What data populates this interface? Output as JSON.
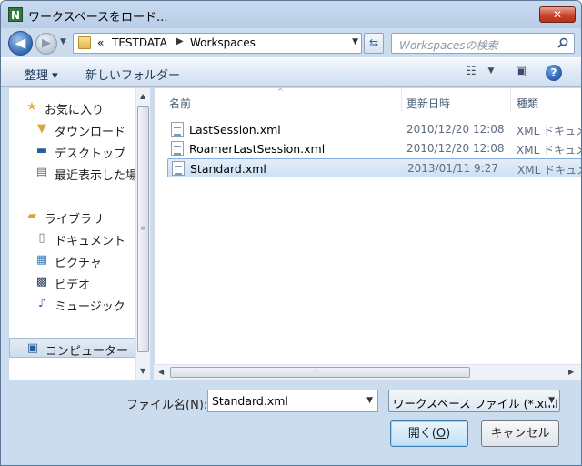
{
  "window": {
    "title": "ワークスペースをロード...",
    "app_icon_letter": "N"
  },
  "address": {
    "overflow": "«",
    "crumbs": [
      "TESTDATA",
      "Workspaces"
    ]
  },
  "search": {
    "placeholder": "Workspacesの検索"
  },
  "toolbar": {
    "organize": "整理 ▾",
    "new_folder": "新しいフォルダー"
  },
  "nav": {
    "favorites": "お気に入り",
    "downloads": "ダウンロード",
    "desktop": "デスクトップ",
    "recent": "最近表示した場所",
    "libraries": "ライブラリ",
    "documents": "ドキュメント",
    "pictures": "ピクチャ",
    "videos": "ビデオ",
    "music": "ミュージック",
    "computer": "コンピューター"
  },
  "columns": {
    "name": "名前",
    "date": "更新日時",
    "type": "種類"
  },
  "files": [
    {
      "name": "LastSession.xml",
      "date": "2010/12/20 12:08",
      "type": "XML ドキュメント"
    },
    {
      "name": "RoamerLastSession.xml",
      "date": "2010/12/20 12:08",
      "type": "XML ドキュメント"
    },
    {
      "name": "Standard.xml",
      "date": "2013/01/11 9:27",
      "type": "XML ドキュメント",
      "selected": true
    }
  ],
  "footer": {
    "filename_label": "ファイル名(",
    "filename_key": "N",
    "filename_label_end": "):",
    "filename_value": "Standard.xml",
    "filter_value": "ワークスペース ファイル (*.xml)",
    "open_label": "開く(",
    "open_key": "O",
    "open_label_end": ")",
    "cancel_label": "キャンセル"
  },
  "colors": {
    "selection": "#cce0f6",
    "window_bg": "#cbdcef",
    "close": "#c7442c"
  }
}
